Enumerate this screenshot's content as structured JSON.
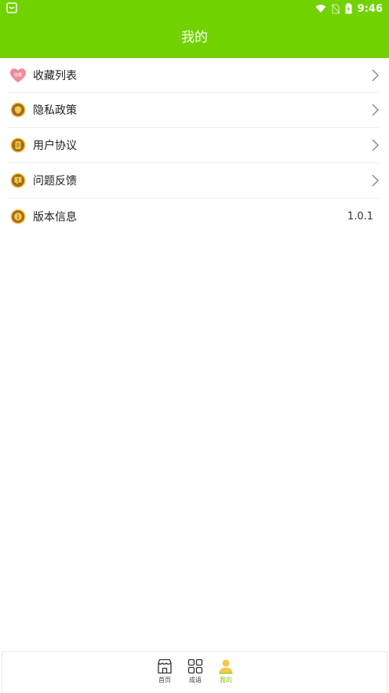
{
  "status_bar": {
    "time": "9:46",
    "icons": [
      "notification-icon",
      "wifi-icon",
      "no-sim-icon",
      "battery-charging-icon"
    ]
  },
  "header": {
    "title": "我的",
    "background": "#72d200"
  },
  "menu": {
    "items": [
      {
        "label": "收藏列表",
        "icon": "heart-favorite-icon",
        "icon_text": "收藏",
        "icon_color": "#f08a9a"
      },
      {
        "label": "隐私政策",
        "icon": "privacy-icon",
        "icon_color": "#a5691a"
      },
      {
        "label": "用户协议",
        "icon": "agreement-icon",
        "icon_color": "#a5691a"
      },
      {
        "label": "问题反馈",
        "icon": "feedback-icon",
        "icon_color": "#a5691a"
      },
      {
        "label": "版本信息",
        "icon": "info-icon",
        "icon_color": "#a5691a",
        "value": "1.0.1"
      }
    ]
  },
  "tabbar": {
    "tabs": [
      {
        "label": "首页",
        "icon": "home-icon",
        "active": false
      },
      {
        "label": "成语",
        "icon": "grid-icon",
        "active": false
      },
      {
        "label": "我的",
        "icon": "user-icon",
        "active": true
      }
    ],
    "active_color": "#8bc400"
  }
}
